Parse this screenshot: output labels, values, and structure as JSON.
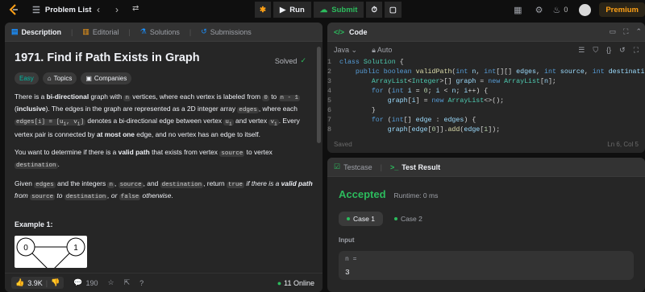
{
  "topbar": {
    "problem_list": "Problem List",
    "run": "Run",
    "submit": "Submit",
    "streak_count": "0",
    "premium": "Premium"
  },
  "left": {
    "tabs": [
      "Description",
      "Editorial",
      "Solutions",
      "Submissions"
    ],
    "title": "1971. Find if Path Exists in Graph",
    "solved": "Solved",
    "chips": [
      "Easy",
      "Topics",
      "Companies"
    ],
    "example": "Example 1:",
    "graph_nodes": [
      "0",
      "1"
    ],
    "footer": {
      "likes": "3.9K",
      "comments": "190",
      "online": "11 Online"
    }
  },
  "code": {
    "title": "Code",
    "language": "Java",
    "auto": "Auto",
    "line_numbers": [
      "1",
      "2",
      "3",
      "4",
      "5",
      "6",
      "7",
      "8"
    ],
    "status": "Saved",
    "position": "Ln 6, Col 5"
  },
  "result": {
    "tabs": [
      "Testcase",
      "Test Result"
    ],
    "verdict": "Accepted",
    "runtime": "Runtime: 0 ms",
    "cases": [
      "Case 1",
      "Case 2"
    ],
    "input_label": "Input",
    "var_name": "n =",
    "var_value": "3"
  },
  "colors": {
    "accent": "#ffa116",
    "success": "#2cbb5d",
    "easy": "#00b8a3"
  }
}
